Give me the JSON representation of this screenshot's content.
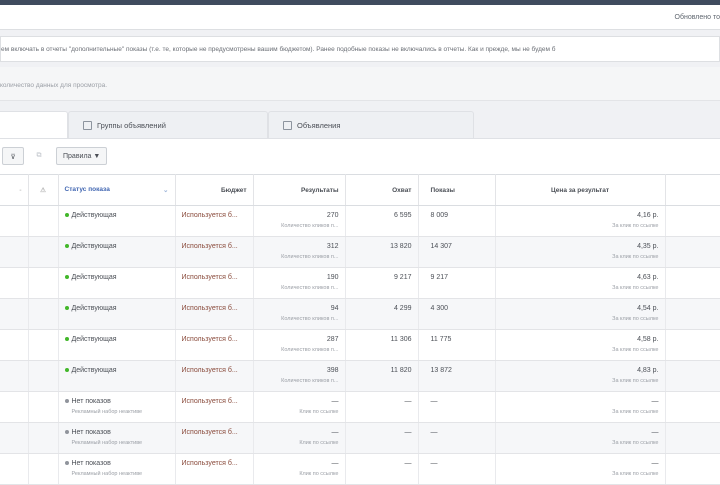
{
  "header": {
    "updated": "Обновлено то"
  },
  "notice": "ем включать в отчеты \"дополнительные\" показы (т.е. те, которые не предусмотрены вашим бюджетом). Ранее подобные показы не включались в отчеты. Как и прежде, мы не будем б",
  "info": "количество данных для просмотра.",
  "tabs": [
    {
      "label": "Группы объявлений",
      "icon": "ad-sets-icon"
    },
    {
      "label": "Объявления",
      "icon": "ads-icon"
    }
  ],
  "toolbar": {
    "rules": "Правила ▼"
  },
  "columns": {
    "status": "Статус показа",
    "budget": "Бюджет",
    "results": "Результаты",
    "reach": "Охват",
    "impressions": "Показы",
    "cost": "Цена за результат"
  },
  "colors": {
    "active": "#42b72a",
    "inactive": "#90949c",
    "link": "#4267b2"
  },
  "rows": [
    {
      "status": "Действующая",
      "budget": "Используется б...",
      "results": "270",
      "results_sub": "Количество кликов п...",
      "reach": "6 595",
      "impressions": "8 009",
      "cost": "4,16 р.",
      "cost_sub": "За клик по ссылке",
      "active": true
    },
    {
      "status": "Действующая",
      "budget": "Используется б...",
      "results": "312",
      "results_sub": "Количество кликов п...",
      "reach": "13 820",
      "impressions": "14 307",
      "cost": "4,35 р.",
      "cost_sub": "За клик по ссылке",
      "active": true
    },
    {
      "status": "Действующая",
      "budget": "Используется б...",
      "results": "190",
      "results_sub": "Количество кликов п...",
      "reach": "9 217",
      "impressions": "9 217",
      "cost": "4,63 р.",
      "cost_sub": "За клик по ссылке",
      "active": true
    },
    {
      "status": "Действующая",
      "budget": "Используется б...",
      "results": "94",
      "results_sub": "Количество кликов п...",
      "reach": "4 299",
      "impressions": "4 300",
      "cost": "4,54 р.",
      "cost_sub": "За клик по ссылке",
      "active": true
    },
    {
      "status": "Действующая",
      "budget": "Используется б...",
      "results": "287",
      "results_sub": "Количество кликов п...",
      "reach": "11 306",
      "impressions": "11 775",
      "cost": "4,58 р.",
      "cost_sub": "За клик по ссылке",
      "active": true
    },
    {
      "status": "Действующая",
      "budget": "Используется б...",
      "results": "398",
      "results_sub": "Количество кликов п...",
      "reach": "11 820",
      "impressions": "13 872",
      "cost": "4,83 р.",
      "cost_sub": "За клик по ссылке",
      "active": true
    },
    {
      "status": "Нет показов",
      "status_sub": "Рекламный набор неактиве",
      "budget": "Используется б...",
      "results": "—",
      "results_sub": "Клик по ссылке",
      "reach": "—",
      "impressions": "—",
      "cost": "—",
      "cost_sub": "За клик по ссылке",
      "active": false
    },
    {
      "status": "Нет показов",
      "status_sub": "Рекламный набор неактиве",
      "budget": "Используется б...",
      "results": "—",
      "results_sub": "Клик по ссылке",
      "reach": "—",
      "impressions": "—",
      "cost": "—",
      "cost_sub": "За клик по ссылке",
      "active": false
    },
    {
      "status": "Нет показов",
      "status_sub": "Рекламный набор неактиве",
      "budget": "Используется б...",
      "results": "—",
      "results_sub": "Клик по ссылке",
      "reach": "—",
      "impressions": "—",
      "cost": "—",
      "cost_sub": "За клик по ссылке",
      "active": false
    }
  ]
}
